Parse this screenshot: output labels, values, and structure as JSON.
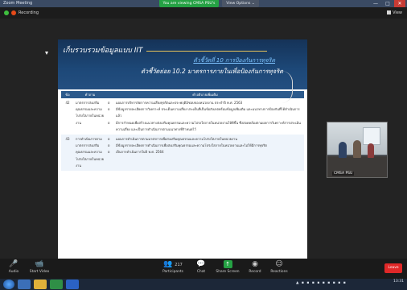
{
  "window": {
    "title": "Zoom Meeting",
    "share_banner": "You are viewing CMSA PSU's screen",
    "view_options": "View Options ⌄",
    "controls": [
      "—",
      "□",
      "✕"
    ]
  },
  "topbar": {
    "recording_label": "Recording",
    "view_label": "View"
  },
  "slide": {
    "title": "เก็บรวบรวมข้อมูลแบบ IIT",
    "subtitle1": "ตัวชี้วัดที่ 10 การป้องกันการทุจริต",
    "subtitle2": "ตัวชี้วัดย่อย 10.2 มาตรการภายในเพื่อป้องกันการทุจริต",
    "headers": [
      "ข้อ",
      "คำถาม",
      "คำอธิบายเพิ่มเติม"
    ],
    "rows": [
      {
        "no": "42",
        "item": "มาตรการส่งเสริมคุณธรรมและความโปร่งใสภายในหน่วยงาน",
        "details": [
          "แผนการบริหารจัดการความเสี่ยงทุจริตและประพฤติมิชอบของหน่วยงาน ประจำปี พ.ศ. 2563",
          "มีข้อมูลรายละเอียดการวิเคราะห์ ประเด็นความเสี่ยง ประเด็นที่เป็นข้อสังเกตพร้อมข้อมูลเพิ่มเติม และแนวทางการป้องกันที่ได้ดำเนินการแล้ว",
          "มีการกำหนดเพื่อสร้างแนวทางส่งเสริมคุณธรรมและความโปร่งใสภายในหน่วยงานให้ดีขึ้น ซึ่งสอดคล้องตามผลการวิเคราะห์การประเมินความเสี่ยง และเป็นการดำเนินการตามแนวทางที่กำหนดไว้"
        ]
      },
      {
        "no": "43",
        "item": "การดำเนินการตามมาตรการส่งเสริมคุณธรรมและความโปร่งใสภายในหน่วยงาน",
        "details": [
          "แผนการดำเนินการตามมาตรการเพื่อส่งเสริมคุณธรรมและความโปร่งใสภายในหน่วยงาน",
          "มีข้อมูลรายละเอียดการดำเนินการเพื่อส่งเสริมคุณธรรมและความโปร่งใสภายในหน่วยงานและไม่ให้มีการทุจริต",
          "เป็นการดำเนินการในปี พ.ศ. 2564"
        ]
      }
    ]
  },
  "participant": {
    "name": "CMSA PSU"
  },
  "toolbar": {
    "items": [
      {
        "label": "Audio",
        "icon": "🎤"
      },
      {
        "label": "Start Video",
        "icon": "📹"
      },
      {
        "label": "Participants",
        "icon": "👥",
        "count": "217"
      },
      {
        "label": "Chat",
        "icon": "💬"
      },
      {
        "label": "Share Screen",
        "icon": "↑"
      },
      {
        "label": "Record",
        "icon": "◉"
      },
      {
        "label": "Reactions",
        "icon": "☺"
      }
    ],
    "leave_label": "Leave"
  },
  "taskbar": {
    "time": "13:31"
  }
}
